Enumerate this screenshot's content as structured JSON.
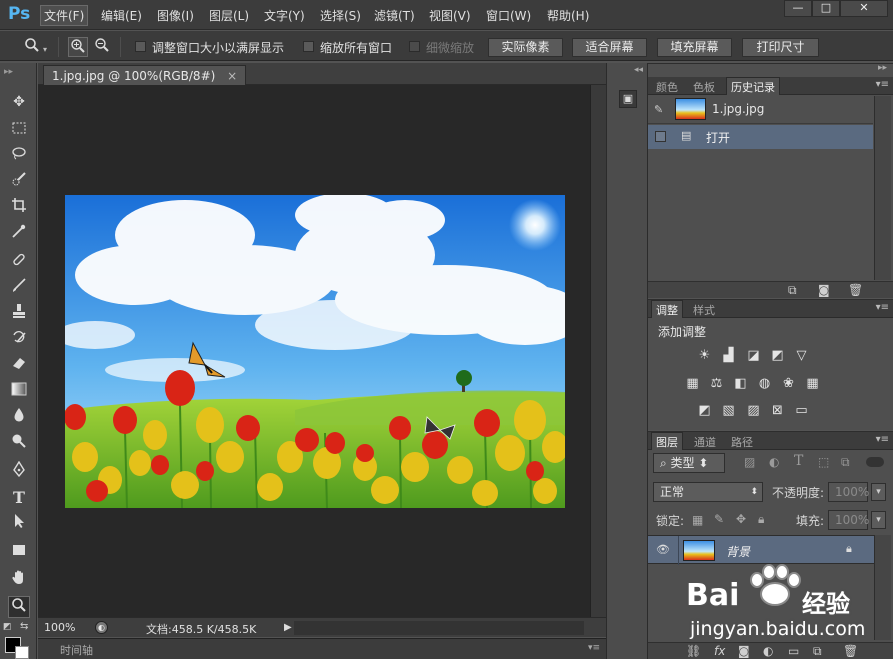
{
  "app": {
    "logo": "Ps"
  },
  "menu": {
    "items": [
      "文件(F)",
      "编辑(E)",
      "图像(I)",
      "图层(L)",
      "文字(Y)",
      "选择(S)",
      "滤镜(T)",
      "视图(V)",
      "窗口(W)",
      "帮助(H)"
    ],
    "active": "文件(F)"
  },
  "window_controls": {
    "minimize": "—",
    "maximize": "□",
    "close": "✕"
  },
  "options": {
    "tool_icon": "zoom-icon",
    "zoom_in_icon": "zoom-in-icon",
    "zoom_out_icon": "zoom-out-icon",
    "resize_windows_label": "调整窗口大小以满屏显示",
    "zoom_all_windows_label": "缩放所有窗口",
    "scrubby_zoom_label": "细微缩放",
    "actual_pixels_label": "实际像素",
    "fit_screen_label": "适合屏幕",
    "fill_screen_label": "填充屏幕",
    "print_size_label": "打印尺寸"
  },
  "tools": [
    "move-tool",
    "marquee-tool",
    "lasso-tool",
    "quick-selection-tool",
    "crop-tool",
    "eyedropper-tool",
    "healing-brush-tool",
    "brush-tool",
    "clone-stamp-tool",
    "history-brush-tool",
    "eraser-tool",
    "gradient-tool",
    "blur-tool",
    "dodge-tool",
    "pen-tool",
    "type-tool",
    "path-selection-tool",
    "rectangle-tool",
    "hand-tool",
    "zoom-tool"
  ],
  "document": {
    "tab_title": "1.jpg.jpg @ 100%(RGB/8#)",
    "tab_close": "×",
    "zoom": "100%",
    "doc_size": "文档:458.5 K/458.5K",
    "timeline_label": "时间轴"
  },
  "history_panel": {
    "tabs": [
      "颜色",
      "色板",
      "历史记录"
    ],
    "active_tab": "历史记录",
    "snapshot_name": "1.jpg.jpg",
    "steps": [
      "打开"
    ]
  },
  "adjustments_panel": {
    "tabs": [
      "调整",
      "样式"
    ],
    "active_tab": "调整",
    "heading": "添加调整"
  },
  "layers_panel": {
    "tabs": [
      "图层",
      "通道",
      "路径"
    ],
    "active_tab": "图层",
    "filter_kind": "类型",
    "blend_mode": "正常",
    "opacity_label": "不透明度:",
    "opacity_value": "100%",
    "lock_label": "锁定:",
    "fill_label": "填充:",
    "fill_value": "100%",
    "layers": [
      {
        "name": "背景",
        "visible": true,
        "locked": true
      }
    ]
  },
  "watermark": {
    "brand": "Bai",
    "brand_suffix": "经验",
    "url": "jingyan.baidu.com"
  }
}
